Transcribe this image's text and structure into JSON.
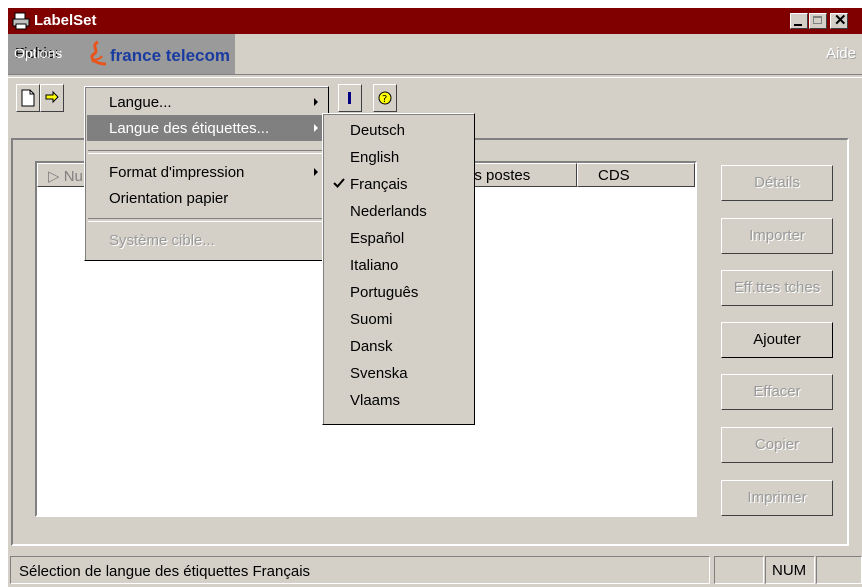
{
  "window": {
    "title": "LabelSet",
    "close_glyph": "✕"
  },
  "menubar": {
    "fichier": "Fichier",
    "options": "Options",
    "brand": "france telecom",
    "aide": "Aide"
  },
  "options_menu": {
    "items": [
      {
        "label": "Langue...",
        "submenu": true,
        "state": "normal"
      },
      {
        "label": "Langue des étiquettes...",
        "submenu": true,
        "state": "highlighted"
      },
      {
        "label": "Format d'impression",
        "submenu": true,
        "state": "normal"
      },
      {
        "label": "Orientation papier",
        "submenu": false,
        "state": "normal"
      },
      {
        "label": "Système cible...",
        "submenu": false,
        "state": "disabled"
      }
    ]
  },
  "language_menu": {
    "items": [
      "Deutsch",
      "English",
      "Français",
      "Nederlands",
      "Español",
      "Italiano",
      "Português",
      "Suomi",
      "Dansk",
      "Svenska",
      "Vlaams"
    ],
    "checked": "Français"
  },
  "list": {
    "columns": [
      "Nu",
      "es postes",
      "CDS"
    ]
  },
  "buttons": {
    "details": "Détails",
    "importer": "Importer",
    "eff_ttes_tches": "Eff.ttes tches",
    "ajouter": "Ajouter",
    "effacer": "Effacer",
    "copier": "Copier",
    "imprimer": "Imprimer"
  },
  "statusbar": {
    "text": "Sélection de langue des étiquettes Français",
    "num": "NUM"
  },
  "colors": {
    "titlebar": "#800000",
    "face": "#d4d0c8",
    "highlight": "#808080",
    "brand_blue": "#1a3ca0",
    "brand_orange": "#e8541c"
  }
}
